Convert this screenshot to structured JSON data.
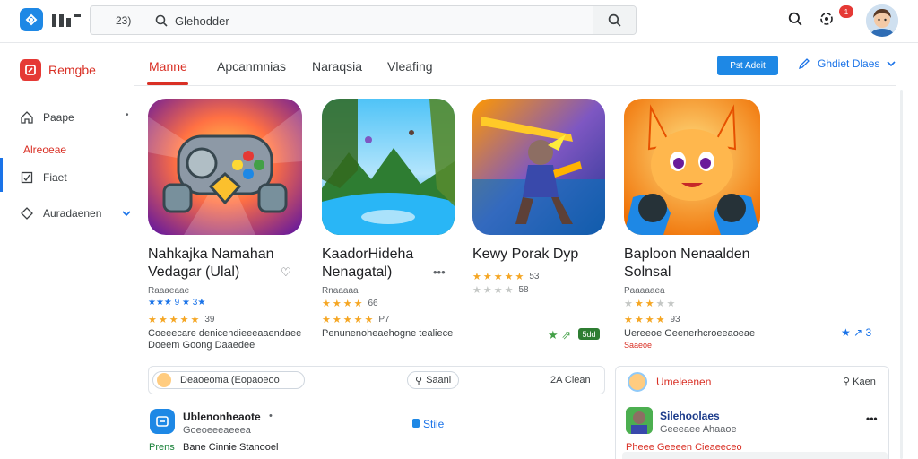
{
  "topbar": {
    "search_prefix": "23)",
    "search_placeholder": "Glehodder",
    "notification_count": "1"
  },
  "sidebar": {
    "brand_label": "Remgbe",
    "items": [
      {
        "label": "Paape"
      },
      {
        "label": "Fiaet"
      },
      {
        "label": "Auradaenen"
      }
    ],
    "section_label": "Alreoeae"
  },
  "tabs": [
    {
      "label": "Manne"
    },
    {
      "label": "Apcanmnias"
    },
    {
      "label": "Naraqsia"
    },
    {
      "label": "Vleafing"
    }
  ],
  "header_actions": {
    "primary_button": "Pst Adeit",
    "dropdown_label": "Ghdiet Dlaes"
  },
  "games": [
    {
      "title_line1": "Nahkajka Namahan",
      "title_line2": "Vedagar (Ulal)",
      "developer": "Raaaeaae",
      "sub_rating": "★★★ 9 ★ 3★",
      "rating": "39",
      "desc_line1": "Coeeecare denicehdieeeaaendaee",
      "desc_line2": "Doeem Goong Daaedee"
    },
    {
      "title_line1": "KaadorHideha",
      "title_line2": "Nenagatal)",
      "developer": "Rnaaaaa",
      "sub_rating": "66",
      "rating": "P7",
      "desc_line1": "Penunenoheaehogne tealiece"
    },
    {
      "title_line1": "Kewy Porak Dyp",
      "sub_rating": "53",
      "sub_rating2": "58",
      "badge": "5dd"
    },
    {
      "title_line1": "Baploon Nenaalden",
      "title_line2": "Solnsal",
      "developer": "Paaaaaea",
      "rating": "93",
      "desc_line1": "Uereeoe Geenerhcroeeaoeae",
      "desc_line2": "Saaeoe",
      "side_ratings": "3"
    }
  ],
  "bottom_left": {
    "chip1": "Deaoeoma (Eopaoeoo",
    "chip2": "Saani",
    "chip3": "2A Clean",
    "item_title": "Ublenonheaote",
    "item_sub": "Goeoeeeaeeea",
    "item_action": "Stiie",
    "footer_prefix": "Prens",
    "footer_text": "Bane Cinnie Stanooel"
  },
  "bottom_right": {
    "header_label": "Umeleenen",
    "header_action": "Kaen",
    "item_title": "Silehoolaes",
    "item_sub": "Geeeaee Ahaaoe",
    "footer_text": "Pheee Geeeen Cieaeeceo"
  }
}
